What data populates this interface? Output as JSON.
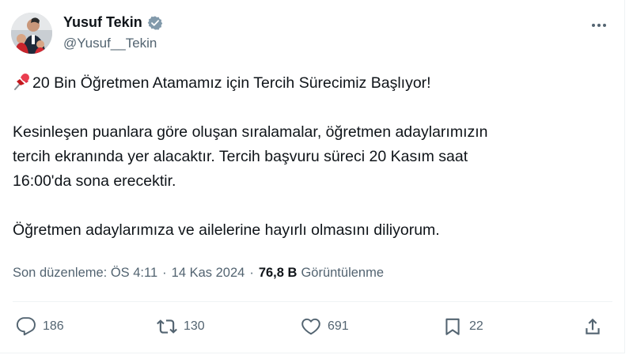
{
  "author": {
    "display_name": "Yusuf Tekin",
    "handle": "@Yusuf__Tekin",
    "verified": true
  },
  "post": {
    "headline_emoji": "pushpin-icon",
    "headline": "20 Bin Öğretmen Atamamız için Tercih Sürecimiz Başlıyor!",
    "paragraph1_line1": "Kesinleşen puanlara göre oluşan sıralamalar, öğretmen adaylarımızın",
    "paragraph1_line2": "tercih ekranında yer alacaktır. Tercih başvuru süreci 20 Kasım saat",
    "paragraph1_line3": "16:00'da sona erecektir.",
    "paragraph2": "Öğretmen adaylarımıza ve ailelerine hayırlı olmasını diliyorum."
  },
  "meta": {
    "edited_label": "Son düzenleme: ÖS 4:11",
    "separator1": "·",
    "date": "14 Kas 2024",
    "separator2": "·",
    "views_count": "76,8 B",
    "views_label": "Görüntülenme"
  },
  "actions": {
    "replies": "186",
    "reposts": "130",
    "likes": "691",
    "bookmarks": "22"
  },
  "colors": {
    "text": "#0f1419",
    "secondary": "#536471",
    "verified_badge": "#829aab",
    "divider": "#eff3f4"
  }
}
